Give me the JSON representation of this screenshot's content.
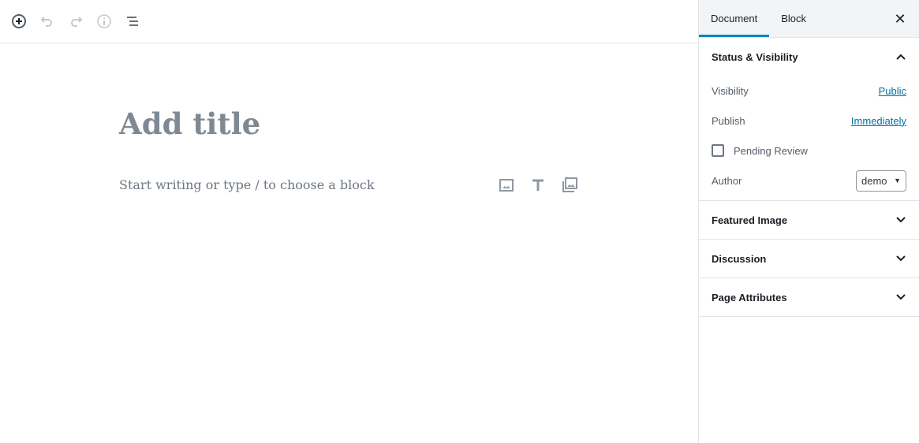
{
  "toolbar": {
    "icons": [
      "plus-circle-icon",
      "undo-icon",
      "redo-icon",
      "info-icon",
      "list-view-icon"
    ]
  },
  "editor": {
    "title_placeholder": "Add title",
    "paragraph_placeholder": "Start writing or type / to choose a block",
    "inserters": [
      "image-icon",
      "heading-icon",
      "gallery-icon"
    ]
  },
  "sidebar": {
    "tabs": [
      {
        "label": "Document",
        "active": true
      },
      {
        "label": "Block",
        "active": false
      }
    ],
    "status": {
      "title": "Status & Visibility",
      "visibility_label": "Visibility",
      "visibility_value": "Public",
      "publish_label": "Publish",
      "publish_value": "Immediately",
      "pending_label": "Pending Review",
      "pending_checked": false,
      "author_label": "Author",
      "author_value": "demo"
    },
    "panels": [
      {
        "title": "Featured Image"
      },
      {
        "title": "Discussion"
      },
      {
        "title": "Page Attributes"
      }
    ]
  },
  "colors": {
    "accent": "#0085ba",
    "link": "#0073aa"
  }
}
